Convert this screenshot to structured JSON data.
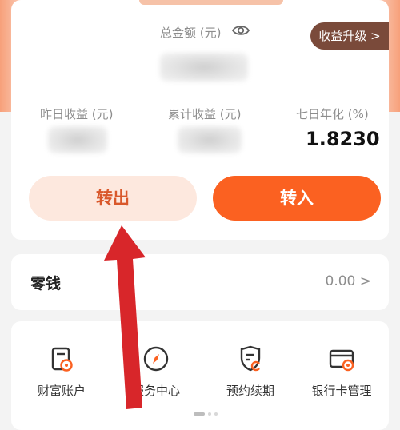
{
  "header": {
    "total_label": "总金额 (元)",
    "upgrade_button": "收益升级 >"
  },
  "stats": [
    {
      "label": "昨日收益 (元)",
      "value": ""
    },
    {
      "label": "累计收益 (元)",
      "value": ""
    },
    {
      "label": "七日年化 (%)",
      "value": "1.8230"
    }
  ],
  "actions": {
    "transfer_out": "转出",
    "transfer_in": "转入"
  },
  "change": {
    "label": "零钱",
    "value": "0.00 >"
  },
  "services": [
    {
      "label": "财富账户",
      "icon": "wealth-account-icon"
    },
    {
      "label": "服务中心",
      "icon": "compass-icon"
    },
    {
      "label": "预约续期",
      "icon": "shield-renew-icon"
    },
    {
      "label": "银行卡管理",
      "icon": "bank-card-icon"
    }
  ],
  "colors": {
    "accent": "#fb6121",
    "accent_light": "#fde8de",
    "upgrade_bg": "#7a4a3a",
    "annotation_arrow": "#d8262a"
  }
}
